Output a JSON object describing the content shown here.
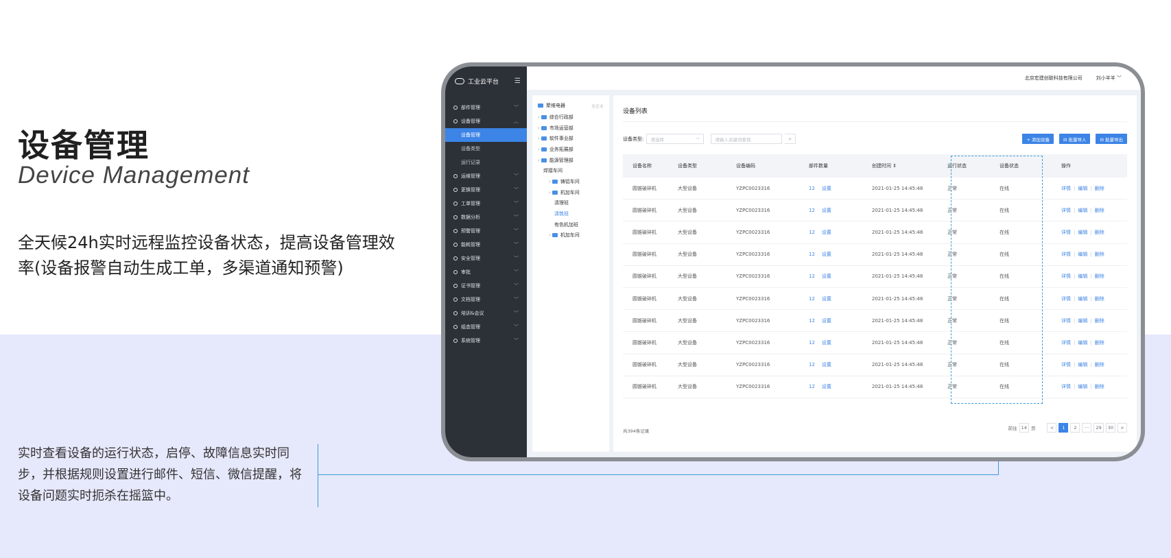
{
  "hero": {
    "title": "设备管理",
    "subtitle": "Device Management",
    "description": "全天候24h实时远程监控设备状态，提高设备管理效率(设备报警自动生成工单，多渠道通知预警)"
  },
  "callout": {
    "text": "实时查看设备的运行状态，启停、故障信息实时同步，并根据规则设置进行邮件、短信、微信提醒，将设备问题实时扼杀在摇篮中。"
  },
  "app": {
    "brand": "工业云平台",
    "company": "北京宏建创联科技有限公司",
    "user": "刘小羊羊 ﹀",
    "nav": [
      {
        "label": "部件管理"
      },
      {
        "label": "设备管理",
        "open": true,
        "children": [
          {
            "label": "设备管理",
            "active": true
          },
          {
            "label": "设备类型"
          },
          {
            "label": "运行记录"
          }
        ]
      },
      {
        "label": "运维管理"
      },
      {
        "label": "更换管理"
      },
      {
        "label": "工单管理"
      },
      {
        "label": "数据分析"
      },
      {
        "label": "预警管理"
      },
      {
        "label": "能耗管理"
      },
      {
        "label": "安全管理"
      },
      {
        "label": "审批"
      },
      {
        "label": "证书管理"
      },
      {
        "label": "文档管理"
      },
      {
        "label": "培训&会议"
      },
      {
        "label": "组态管理"
      },
      {
        "label": "系统管理"
      }
    ],
    "tree": {
      "root": "聚维电器",
      "root_more": "全企业",
      "nodes": [
        {
          "label": "综合行政部",
          "level": 1,
          "folder": true
        },
        {
          "label": "市场运营部",
          "level": 1,
          "folder": true
        },
        {
          "label": "软件事业部",
          "level": 1,
          "folder": true
        },
        {
          "label": "业务拓展部",
          "level": 1,
          "folder": true
        },
        {
          "label": "能源管理部",
          "level": 1,
          "folder": true
        },
        {
          "label": "焊接车间",
          "level": 2,
          "folder": false
        },
        {
          "label": "铸铝车间",
          "level": 3,
          "folder": true
        },
        {
          "label": "机加车间",
          "level": 3,
          "folder": true
        },
        {
          "label": "清理班",
          "level": 4,
          "folder": false
        },
        {
          "label": "清筑班",
          "level": 4,
          "folder": false,
          "selected": true
        },
        {
          "label": "有色机加班",
          "level": 4,
          "folder": false
        },
        {
          "label": "机加车间",
          "level": 3,
          "folder": true
        }
      ]
    },
    "main": {
      "title": "设备列表",
      "filter_label": "设备类型:",
      "select_placeholder": "请选择",
      "search_placeholder": "请输入关键词查询",
      "buttons": [
        "+ 添加设备",
        "⊟ 批量导入",
        "⊟ 批量导出"
      ],
      "columns": [
        "设备名称",
        "设备类型",
        "设备编码",
        "部件数量",
        "创建时间 ⇕",
        "运行状态",
        "设备状态",
        "操作"
      ],
      "rows": [
        {
          "name": "圆锥破碎机",
          "type": "大型设备",
          "code": "YZPC0023316",
          "qty": "12",
          "set": "设置",
          "time": "2021-01-25 14:45:48",
          "run": "正常",
          "status": "在线"
        },
        {
          "name": "圆锥破碎机",
          "type": "大型设备",
          "code": "YZPC0023316",
          "qty": "12",
          "set": "设置",
          "time": "2021-01-25 14:45:48",
          "run": "正常",
          "status": "在线"
        },
        {
          "name": "圆锥破碎机",
          "type": "大型设备",
          "code": "YZPC0023316",
          "qty": "12",
          "set": "设置",
          "time": "2021-01-25 14:45:48",
          "run": "正常",
          "status": "在线"
        },
        {
          "name": "圆锥破碎机",
          "type": "大型设备",
          "code": "YZPC0023316",
          "qty": "12",
          "set": "设置",
          "time": "2021-01-25 14:45:48",
          "run": "正常",
          "status": "在线"
        },
        {
          "name": "圆锥破碎机",
          "type": "大型设备",
          "code": "YZPC0023316",
          "qty": "12",
          "set": "设置",
          "time": "2021-01-25 14:45:48",
          "run": "正常",
          "status": "在线"
        },
        {
          "name": "圆锥破碎机",
          "type": "大型设备",
          "code": "YZPC0023316",
          "qty": "12",
          "set": "设置",
          "time": "2021-01-25 14:45:48",
          "run": "正常",
          "status": "在线"
        },
        {
          "name": "圆锥破碎机",
          "type": "大型设备",
          "code": "YZPC0023316",
          "qty": "12",
          "set": "设置",
          "time": "2021-01-25 14:45:48",
          "run": "正常",
          "status": "在线"
        },
        {
          "name": "圆锥破碎机",
          "type": "大型设备",
          "code": "YZPC0023316",
          "qty": "12",
          "set": "设置",
          "time": "2021-01-25 14:45:48",
          "run": "正常",
          "status": "在线"
        },
        {
          "name": "圆锥破碎机",
          "type": "大型设备",
          "code": "YZPC0023316",
          "qty": "12",
          "set": "设置",
          "time": "2021-01-25 14:45:48",
          "run": "正常",
          "status": "在线"
        },
        {
          "name": "圆锥破碎机",
          "type": "大型设备",
          "code": "YZPC0023316",
          "qty": "12",
          "set": "设置",
          "time": "2021-01-25 14:45:48",
          "run": "正常",
          "status": "在线"
        }
      ],
      "ops": [
        "详情",
        "编辑",
        "删除"
      ],
      "total": "共394条记录",
      "goto_prefix": "前往",
      "goto_value": "14",
      "goto_suffix": "页",
      "pages": [
        "<",
        "1",
        "2",
        "···",
        "29",
        "30",
        ">"
      ],
      "current_page": "1"
    }
  },
  "colors": {
    "accent": "#3c84e6",
    "sidebar": "#2c3137",
    "band": "#e6e8fb",
    "callout": "#3c9bd6"
  }
}
